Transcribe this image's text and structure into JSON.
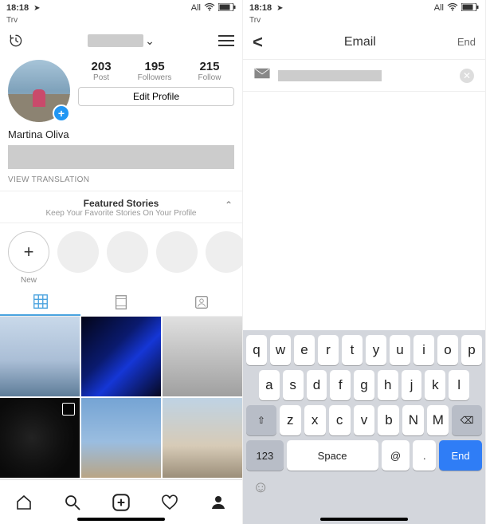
{
  "left": {
    "status": {
      "time": "18:18",
      "carrier_mode": "All"
    },
    "try": "Trv",
    "stats": {
      "posts": {
        "count": "203",
        "label": "Post"
      },
      "followers": {
        "count": "195",
        "label": "Followers"
      },
      "following": {
        "count": "215",
        "label": "Follow"
      }
    },
    "edit_profile": "Edit Profile",
    "display_name": "Martina Oliva",
    "view_translation": "VIEW TRANSLATION",
    "featured": {
      "title": "Featured Stories",
      "subtitle": "Keep Your Favorite Stories On Your Profile",
      "new_label": "New"
    }
  },
  "right": {
    "status": {
      "time": "18:18",
      "carrier_mode": "All"
    },
    "try": "Trv",
    "header": {
      "title": "Email",
      "end": "End"
    },
    "keyboard": {
      "row1": [
        "q",
        "w",
        "e",
        "r",
        "t",
        "y",
        "u",
        "i",
        "o",
        "p"
      ],
      "row2": [
        "a",
        "s",
        "d",
        "f",
        "g",
        "h",
        "j",
        "k",
        "l"
      ],
      "row3_shift": "⇧",
      "row3": [
        "z",
        "x",
        "c",
        "v",
        "b",
        "N",
        "M"
      ],
      "row3_back": "⌫",
      "row4": {
        "numbers": "123",
        "space": "Space",
        "at": "@",
        "dot": ".",
        "end": "End"
      }
    }
  }
}
